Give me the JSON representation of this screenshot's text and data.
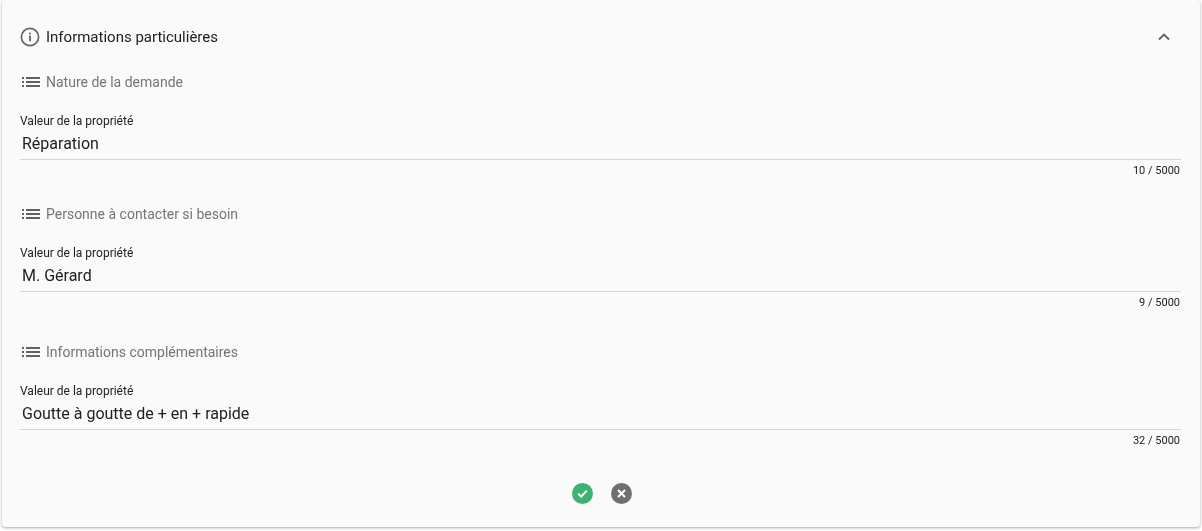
{
  "panel": {
    "title": "Informations particulières",
    "expanded": true
  },
  "properties": [
    {
      "name": "Nature de la demande",
      "label": "Valeur de la propriété",
      "value": "Réparation",
      "counter": "10 / 5000"
    },
    {
      "name": "Personne à contacter si besoin",
      "label": "Valeur de la propriété",
      "value": "M. Gérard",
      "counter": "9 / 5000"
    },
    {
      "name": "Informations complémentaires",
      "label": "Valeur de la propriété",
      "value": "Goutte à goutte de + en + rapide",
      "counter": "32 / 5000"
    }
  ]
}
